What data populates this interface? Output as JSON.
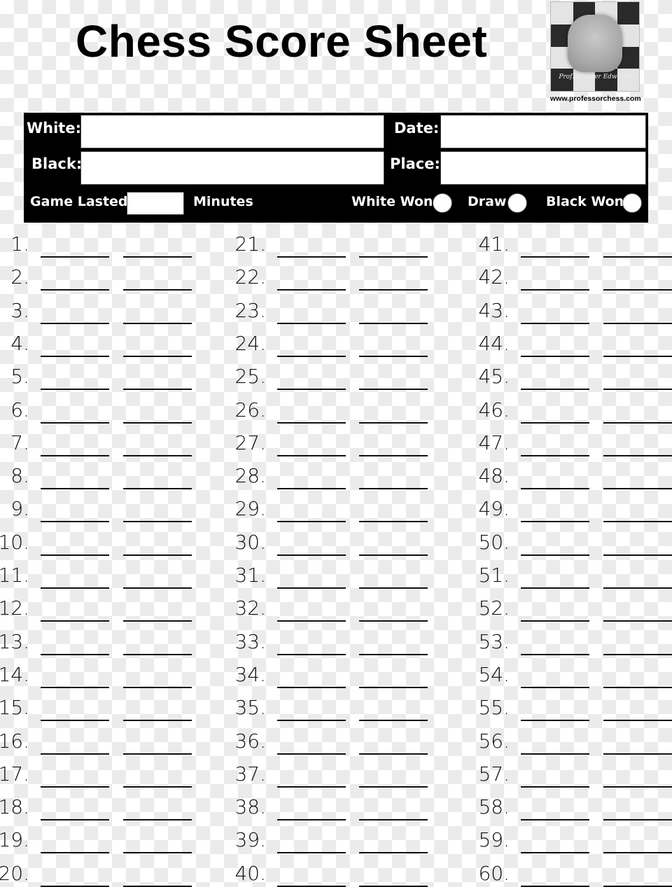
{
  "header": {
    "title": "Chess Score Sheet",
    "logo_name": "professor-chess-logo",
    "logo_signature": "Prof. Chester Edwards",
    "website": "www.professorchess.com"
  },
  "info": {
    "white_label": "White:",
    "white_value": "",
    "black_label": "Black:",
    "black_value": "",
    "date_label": "Date:",
    "date_value": "",
    "place_label": "Place:",
    "place_value": "",
    "game_lasted_label": "Game Lasted",
    "minutes_value": "",
    "minutes_label": "Minutes",
    "results": [
      {
        "label": "White Won",
        "selected": false
      },
      {
        "label": "Draw",
        "selected": false
      },
      {
        "label": "Black Won",
        "selected": false
      }
    ]
  },
  "moves": {
    "columns": [
      {
        "start": 1,
        "end": 20
      },
      {
        "start": 21,
        "end": 40
      },
      {
        "start": 41,
        "end": 60
      }
    ],
    "entries": [
      {
        "n": "1.",
        "white": "",
        "black": ""
      },
      {
        "n": "2.",
        "white": "",
        "black": ""
      },
      {
        "n": "3.",
        "white": "",
        "black": ""
      },
      {
        "n": "4.",
        "white": "",
        "black": ""
      },
      {
        "n": "5.",
        "white": "",
        "black": ""
      },
      {
        "n": "6.",
        "white": "",
        "black": ""
      },
      {
        "n": "7.",
        "white": "",
        "black": ""
      },
      {
        "n": "8.",
        "white": "",
        "black": ""
      },
      {
        "n": "9.",
        "white": "",
        "black": ""
      },
      {
        "n": "10.",
        "white": "",
        "black": ""
      },
      {
        "n": "11.",
        "white": "",
        "black": ""
      },
      {
        "n": "12.",
        "white": "",
        "black": ""
      },
      {
        "n": "13.",
        "white": "",
        "black": ""
      },
      {
        "n": "14.",
        "white": "",
        "black": ""
      },
      {
        "n": "15.",
        "white": "",
        "black": ""
      },
      {
        "n": "16.",
        "white": "",
        "black": ""
      },
      {
        "n": "17.",
        "white": "",
        "black": ""
      },
      {
        "n": "18.",
        "white": "",
        "black": ""
      },
      {
        "n": "19.",
        "white": "",
        "black": ""
      },
      {
        "n": "20.",
        "white": "",
        "black": ""
      },
      {
        "n": "21.",
        "white": "",
        "black": ""
      },
      {
        "n": "22.",
        "white": "",
        "black": ""
      },
      {
        "n": "23.",
        "white": "",
        "black": ""
      },
      {
        "n": "24.",
        "white": "",
        "black": ""
      },
      {
        "n": "25.",
        "white": "",
        "black": ""
      },
      {
        "n": "26.",
        "white": "",
        "black": ""
      },
      {
        "n": "27.",
        "white": "",
        "black": ""
      },
      {
        "n": "28.",
        "white": "",
        "black": ""
      },
      {
        "n": "29.",
        "white": "",
        "black": ""
      },
      {
        "n": "30.",
        "white": "",
        "black": ""
      },
      {
        "n": "31.",
        "white": "",
        "black": ""
      },
      {
        "n": "32.",
        "white": "",
        "black": ""
      },
      {
        "n": "33.",
        "white": "",
        "black": ""
      },
      {
        "n": "34.",
        "white": "",
        "black": ""
      },
      {
        "n": "35.",
        "white": "",
        "black": ""
      },
      {
        "n": "36.",
        "white": "",
        "black": ""
      },
      {
        "n": "37.",
        "white": "",
        "black": ""
      },
      {
        "n": "38.",
        "white": "",
        "black": ""
      },
      {
        "n": "39.",
        "white": "",
        "black": ""
      },
      {
        "n": "40.",
        "white": "",
        "black": ""
      },
      {
        "n": "41.",
        "white": "",
        "black": ""
      },
      {
        "n": "42.",
        "white": "",
        "black": ""
      },
      {
        "n": "43.",
        "white": "",
        "black": ""
      },
      {
        "n": "44.",
        "white": "",
        "black": ""
      },
      {
        "n": "45.",
        "white": "",
        "black": ""
      },
      {
        "n": "46.",
        "white": "",
        "black": ""
      },
      {
        "n": "47.",
        "white": "",
        "black": ""
      },
      {
        "n": "48.",
        "white": "",
        "black": ""
      },
      {
        "n": "49.",
        "white": "",
        "black": ""
      },
      {
        "n": "50.",
        "white": "",
        "black": ""
      },
      {
        "n": "51.",
        "white": "",
        "black": ""
      },
      {
        "n": "52.",
        "white": "",
        "black": ""
      },
      {
        "n": "53.",
        "white": "",
        "black": ""
      },
      {
        "n": "54.",
        "white": "",
        "black": ""
      },
      {
        "n": "55.",
        "white": "",
        "black": ""
      },
      {
        "n": "56.",
        "white": "",
        "black": ""
      },
      {
        "n": "57.",
        "white": "",
        "black": ""
      },
      {
        "n": "58.",
        "white": "",
        "black": ""
      },
      {
        "n": "59.",
        "white": "",
        "black": ""
      },
      {
        "n": "60.",
        "white": "",
        "black": ""
      }
    ]
  },
  "colors": {
    "ink": "#000000",
    "paper": "#ffffff",
    "checker": "#ebebeb"
  }
}
